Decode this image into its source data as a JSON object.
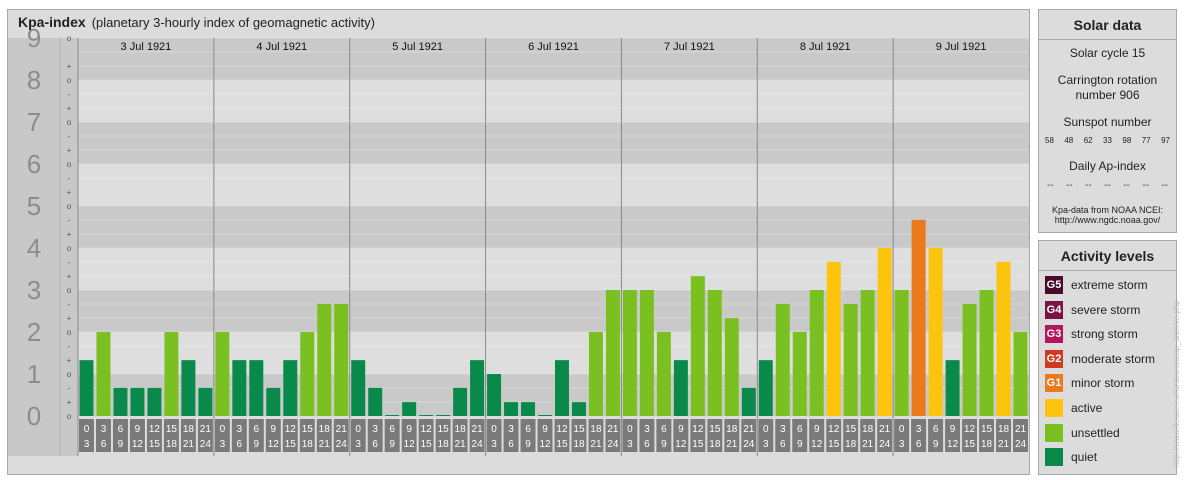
{
  "header": {
    "title": "Kpa-index",
    "subtitle": "(planetary 3-hourly index of geomagnetic activity)"
  },
  "chart_data": {
    "type": "bar",
    "title": "Kpa-index",
    "subtitle": "(planetary 3-hourly index of geomagnetic activity)",
    "ylim": [
      0,
      9
    ],
    "y_tick_labels": [
      "0",
      "1",
      "2",
      "3",
      "4",
      "5",
      "6",
      "7",
      "8",
      "9"
    ],
    "minor_tick_labels": [
      "-",
      "o",
      "+"
    ],
    "days": [
      "3 Jul 1921",
      "4 Jul 1921",
      "5 Jul 1921",
      "6 Jul 1921",
      "7 Jul 1921",
      "8 Jul 1921",
      "9 Jul 1921"
    ],
    "interval_start": [
      "0",
      "3",
      "6",
      "9",
      "12",
      "15",
      "18",
      "21"
    ],
    "interval_end": [
      "3",
      "6",
      "9",
      "12",
      "15",
      "18",
      "21",
      "24"
    ],
    "values": [
      1.33,
      2.0,
      0.67,
      0.67,
      0.67,
      2.0,
      1.33,
      0.67,
      2.0,
      1.33,
      1.33,
      0.67,
      1.33,
      2.0,
      2.67,
      2.67,
      1.33,
      0.67,
      0.0,
      0.33,
      0.0,
      0.0,
      0.67,
      1.33,
      1.0,
      0.33,
      0.33,
      0.0,
      1.33,
      0.33,
      2.0,
      3.0,
      3.0,
      3.0,
      2.0,
      1.33,
      3.33,
      3.0,
      2.33,
      0.67,
      1.33,
      2.67,
      2.0,
      3.0,
      3.67,
      2.67,
      3.0,
      4.0,
      3.0,
      4.67,
      4.0,
      1.33,
      2.67,
      3.0,
      3.67,
      2.0
    ],
    "levels": [
      "quiet",
      "unsettled",
      "quiet",
      "quiet",
      "quiet",
      "unsettled",
      "quiet",
      "quiet",
      "unsettled",
      "quiet",
      "quiet",
      "quiet",
      "quiet",
      "unsettled",
      "unsettled",
      "unsettled",
      "quiet",
      "quiet",
      "quiet",
      "quiet",
      "quiet",
      "quiet",
      "quiet",
      "quiet",
      "quiet",
      "quiet",
      "quiet",
      "quiet",
      "quiet",
      "quiet",
      "unsettled",
      "unsettled",
      "unsettled",
      "unsettled",
      "unsettled",
      "quiet",
      "unsettled",
      "unsettled",
      "unsettled",
      "quiet",
      "quiet",
      "unsettled",
      "unsettled",
      "unsettled",
      "active",
      "unsettled",
      "unsettled",
      "active",
      "unsettled",
      "minor",
      "active",
      "quiet",
      "unsettled",
      "unsettled",
      "active",
      "unsettled"
    ],
    "level_colors": {
      "quiet": "#0a8a4a",
      "unsettled": "#7ac021",
      "active": "#fcc40c",
      "minor": "#ea7a1c",
      "moderate": "#d03a21",
      "strong": "#b3165a",
      "severe": "#7a1446",
      "extreme": "#4a0a2a"
    }
  },
  "solar": {
    "heading": "Solar data",
    "cycle": "Solar cycle 15",
    "carrington_1": "Carrington rotation",
    "carrington_2": "number 906",
    "sunspot_label": "Sunspot number",
    "sunspots": [
      "58",
      "48",
      "62",
      "33",
      "98",
      "77",
      "97"
    ],
    "ap_label": "Daily Ap-index",
    "ap_values": [
      "--",
      "--",
      "--",
      "--",
      "--",
      "--",
      "--"
    ],
    "source_1": "Kpa-data from NOAA NCEI:",
    "source_2": "http://www.ngdc.noaa.gov/"
  },
  "activity": {
    "heading": "Activity levels",
    "items": [
      {
        "code": "G5",
        "label": "extreme storm",
        "color": "#4a0a2a"
      },
      {
        "code": "G4",
        "label": "severe storm",
        "color": "#7a1446"
      },
      {
        "code": "G3",
        "label": "strong storm",
        "color": "#b3165a"
      },
      {
        "code": "G2",
        "label": "moderate storm",
        "color": "#d03a21"
      },
      {
        "code": "G1",
        "label": "minor storm",
        "color": "#ea7a1c"
      },
      {
        "code": "",
        "label": "active",
        "color": "#fcc40c"
      },
      {
        "code": "",
        "label": "unsettled",
        "color": "#7ac021"
      },
      {
        "code": "",
        "label": "quiet",
        "color": "#0a8a4a"
      }
    ]
  },
  "credit": "http://www.fleuze.eu/farskurora/ap_archive.php"
}
